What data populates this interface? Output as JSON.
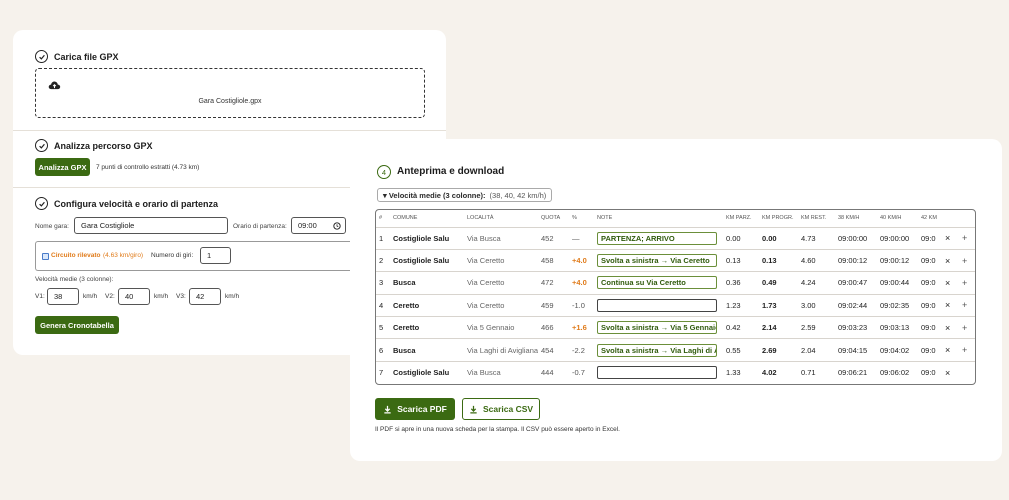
{
  "upload": {
    "title": "Carica file GPX",
    "file_name": "Gara Costigliole.gpx"
  },
  "analyze": {
    "title": "Analizza percorso GPX",
    "button_label": "Analizza GPX",
    "result_text": "7 punti di controllo estratti (4.73 km)"
  },
  "configure": {
    "title": "Configura velocità e orario di partenza",
    "race_name_label": "Nome gara:",
    "race_name_value": "Gara Costigliole",
    "start_time_label": "Orario di partenza:",
    "start_time_value": "09:00",
    "circuit_label": "Circuito rilevato",
    "circuit_length": "(4.63 km/giro)",
    "laps_label": "Numero di giri:",
    "laps_value": "1",
    "speeds_label": "Velocità medie (3 colonne):",
    "v1_label": "V1:",
    "v1_value": "38",
    "v2_label": "V2:",
    "v2_value": "40",
    "v3_label": "V3:",
    "v3_value": "42",
    "unit": "km/h",
    "generate_label": "Genera Cronotabella"
  },
  "preview": {
    "step_number": "4",
    "title": "Anteprima e download",
    "speeds_summary_label": "▾ Velocità medie (3 colonne):",
    "speeds_summary_value": "(38, 40, 42 km/h)",
    "columns": [
      "#",
      "COMUNE",
      "LOCALITÀ",
      "QUOTA",
      "%",
      "NOTE",
      "KM PARZ.",
      "KM PROGR.",
      "KM REST.",
      "38 KM/H",
      "40 KM/H",
      "42 KM",
      "",
      ""
    ],
    "rows": [
      {
        "n": "1",
        "comune": "Costigliole Salu",
        "loc": "Via Busca",
        "quota": "452",
        "pct": "—",
        "note": "PARTENZA; ARRIVO",
        "parz": "0.00",
        "progr": "0.00",
        "rest": "4.73",
        "t38": "09:00:00",
        "t40": "09:00:00",
        "t42": "09:0",
        "x": "×",
        "plus": "+"
      },
      {
        "n": "2",
        "comune": "Costigliole Salu",
        "loc": "Via Ceretto",
        "quota": "458",
        "pct": "+4.0",
        "note": "Svolta a sinistra → Via Ceretto",
        "parz": "0.13",
        "progr": "0.13",
        "rest": "4.60",
        "t38": "09:00:12",
        "t40": "09:00:12",
        "t42": "09:0",
        "x": "×",
        "plus": "+"
      },
      {
        "n": "3",
        "comune": "Busca",
        "loc": "Via Ceretto",
        "quota": "472",
        "pct": "+4.0",
        "note": "Continua su Via Ceretto",
        "parz": "0.36",
        "progr": "0.49",
        "rest": "4.24",
        "t38": "09:00:47",
        "t40": "09:00:44",
        "t42": "09:0",
        "x": "×",
        "plus": "+"
      },
      {
        "n": "4",
        "comune": "Ceretto",
        "loc": "Via Ceretto",
        "quota": "459",
        "pct": "-1.0",
        "note": "",
        "parz": "1.23",
        "progr": "1.73",
        "rest": "3.00",
        "t38": "09:02:44",
        "t40": "09:02:35",
        "t42": "09:0",
        "x": "×",
        "plus": "+"
      },
      {
        "n": "5",
        "comune": "Ceretto",
        "loc": "Via 5 Gennaio",
        "quota": "466",
        "pct": "+1.6",
        "note": "Svolta a sinistra → Via 5 Gennaio",
        "parz": "0.42",
        "progr": "2.14",
        "rest": "2.59",
        "t38": "09:03:23",
        "t40": "09:03:13",
        "t42": "09:0",
        "x": "×",
        "plus": "+"
      },
      {
        "n": "6",
        "comune": "Busca",
        "loc": "Via Laghi di Avigliana",
        "quota": "454",
        "pct": "-2.2",
        "note": "Svolta a sinistra → Via Laghi di Avigliana",
        "parz": "0.55",
        "progr": "2.69",
        "rest": "2.04",
        "t38": "09:04:15",
        "t40": "09:04:02",
        "t42": "09:0",
        "x": "×",
        "plus": "+"
      },
      {
        "n": "7",
        "comune": "Costigliole Salu",
        "loc": "Via Busca",
        "quota": "444",
        "pct": "-0.7",
        "note": "",
        "parz": "1.33",
        "progr": "4.02",
        "rest": "0.71",
        "t38": "09:06:21",
        "t40": "09:06:02",
        "t42": "09:0",
        "x": "×",
        "plus": ""
      }
    ],
    "pdf_label": "Scarica PDF",
    "csv_label": "Scarica CSV",
    "footnote": "Il PDF si apre in una nuova scheda per la stampa. Il CSV può essere aperto in Excel."
  },
  "colors": {
    "accent_green": "#3b6a12",
    "positive_grade": "#e07b1a",
    "background": "#f6f2ec"
  }
}
